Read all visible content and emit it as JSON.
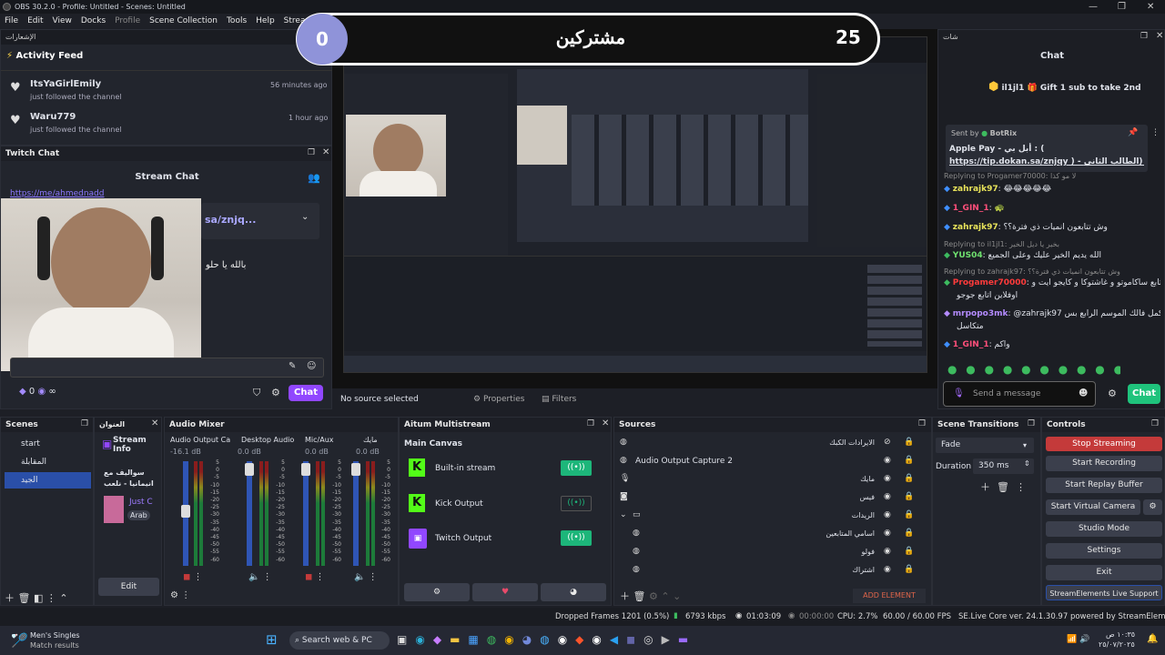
{
  "window": {
    "title": "OBS 30.2.0 - Profile: Untitled - Scenes: Untitled"
  },
  "menu": [
    "File",
    "Edit",
    "View",
    "Docks",
    "Profile",
    "Scene Collection",
    "Tools",
    "Help",
    "StreamEle..."
  ],
  "alert_header": "الإشعارات",
  "activity": {
    "title": "Activity Feed",
    "items": [
      {
        "name": "ItsYaGirlEmily",
        "desc": "just followed the channel",
        "time": "56 minutes ago"
      },
      {
        "name": "Waru779",
        "desc": "just followed the channel",
        "time": "1 hour ago"
      }
    ]
  },
  "twitch_chat": {
    "dock_title": "Twitch Chat",
    "header": "Stream Chat",
    "link_text": "https://me/ahmednadd",
    "paste_text": "sa/znjq...",
    "msg_text": "بالله يا حلو",
    "points": "0",
    "infinity": "∞",
    "chat_btn": "Chat"
  },
  "overlay": {
    "left_count": "0",
    "right_count": "25",
    "label": "مشتركين"
  },
  "preview": {
    "no_source": "No source selected",
    "properties": "Properties",
    "filters": "Filters"
  },
  "chat_panel": {
    "header_label": "شات",
    "title": "Chat",
    "gift_user": "il1jl1",
    "gift_text": "Gift 1 sub to take 2nd",
    "pinned_by": "Sent by",
    "pinned_user": "BotRix",
    "pinned_line1": "Apple Pay - أبل بي : (",
    "pinned_line2": "https://tip.dokan.sa/znjqy ) - رابط الدعم (الطالب الثاني",
    "messages": [
      {
        "type": "reply",
        "text": "Replying to Progamer70000: لا مو كذا"
      },
      {
        "user": "zahrajk97",
        "color": "#e8e35a",
        "text": "😂😂😂😂😂"
      },
      {
        "user": "1_GIN_1",
        "color": "#ff4f7a",
        "text": "🐢"
      },
      {
        "user": "zahrajk97",
        "color": "#e8e35a",
        "text": "وش تتابعون انميات ذي فترة؟؟"
      },
      {
        "type": "reply",
        "text": "Replying to il1jl1: بخير يا ديل الخير"
      },
      {
        "user": "YUS04",
        "color": "#6fe06f",
        "text": "الله يديم الخير عليك وعلى الجميع"
      },
      {
        "type": "reply",
        "text": "Replying to zahrajk97: وش تتابعون انميات ذي فترة؟؟"
      },
      {
        "user": "Progamer70000",
        "color": "#ff3b3b",
        "text": "قاعد اتابع ساكاموتو و غاشتوكا و كايجو ايت و"
      },
      {
        "user": "",
        "color": "#ddd",
        "text": "اوفلاين اتابع جوجو"
      },
      {
        "user": "mrpopo3mk",
        "color": "#b48bff",
        "text": "@zahrajk97 بكمل فالك الموسم الرابع بس"
      },
      {
        "user": "",
        "color": "#ddd",
        "text": "متكاسل"
      },
      {
        "user": "1_GIN_1",
        "color": "#ff4f7a",
        "text": "واكم"
      }
    ],
    "input_placeholder": "Send a message",
    "chat_btn": "Chat"
  },
  "scenes": {
    "title": "Scenes",
    "items": [
      "start",
      "المقابلة",
      "الجيد"
    ],
    "selected": 2
  },
  "stream_info": {
    "tab": "العنوان",
    "title": "Stream Info",
    "line1": "سواليف مع",
    "line2": "انيمانيا - نلعب",
    "just": "Just C",
    "arab": "Arab",
    "edit": "Edit"
  },
  "mixer": {
    "title": "Audio Mixer",
    "channels": [
      {
        "name": "Audio Output Ca",
        "db": "-16.1 dB"
      },
      {
        "name": "Desktop Audio",
        "db": "0.0 dB"
      },
      {
        "name": "Mic/Aux",
        "db": "0.0 dB"
      },
      {
        "name": "مايك",
        "db": "0.0 dB"
      }
    ],
    "scale": [
      "5",
      "0",
      "-5",
      "-10",
      "-15",
      "-20",
      "-25",
      "-30",
      "-35",
      "-40",
      "-45",
      "-50",
      "-55",
      "-60"
    ]
  },
  "multistream": {
    "title": "Aitum Multistream",
    "canvas": "Main Canvas",
    "outputs": [
      "Built-in stream",
      "Kick Output",
      "Twitch Output"
    ]
  },
  "sources": {
    "title": "Sources",
    "items": [
      "الايرادات الكبك",
      "Audio Output Capture 2",
      "مايك",
      "فيس",
      "الريدات",
      "اسامي المتابعين",
      "فولو",
      "اشتراك"
    ],
    "add_element": "ADD ELEMENT"
  },
  "transitions": {
    "title": "Scene Transitions",
    "type": "Fade",
    "duration_label": "Duration",
    "duration": "350 ms"
  },
  "controls": {
    "title": "Controls",
    "stop": "Stop Streaming",
    "record": "Start Recording",
    "replay": "Start Replay Buffer",
    "virtual": "Start Virtual Camera",
    "studio": "Studio Mode",
    "settings": "Settings",
    "exit": "Exit",
    "se": "StreamElements Live Support"
  },
  "status": {
    "dropped": "Dropped Frames 1201 (0.5%)",
    "kbps": "6793 kbps",
    "live_time": "01:03:09",
    "rec_time": "00:00:00",
    "cpu": "CPU: 2.7%",
    "fps": "60.00 / 60.00 FPS",
    "se": "SE.Live Core ver. 24.1.30.97 powered by StreamElements"
  },
  "taskbar": {
    "app_title": "Men's Singles",
    "app_sub": "Match results",
    "search": "Search web & PC",
    "time": "١٠:٣٥ ص",
    "date": "٢٥/٠٧/٢٠٢٥"
  },
  "colors": {
    "stop_btn": "#c43a3a",
    "chat_btn": "#1fc37c",
    "accent": "#2a4fa8",
    "link": "#7f67ff"
  }
}
